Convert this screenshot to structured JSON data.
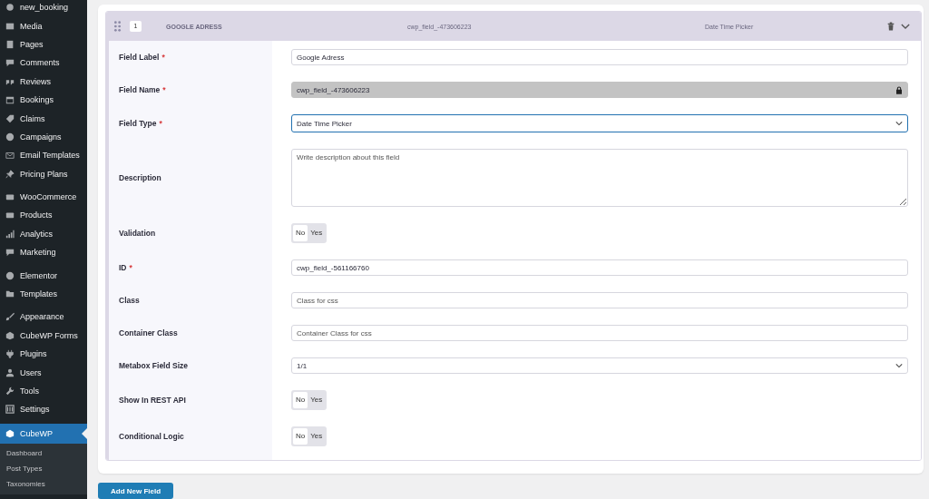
{
  "sidebar": {
    "groups": [
      {
        "items": [
          {
            "label": "new_booking",
            "selected": false
          },
          {
            "label": "Media",
            "selected": false
          },
          {
            "label": "Pages",
            "selected": false
          },
          {
            "label": "Comments",
            "selected": false
          },
          {
            "label": "Reviews",
            "selected": false
          },
          {
            "label": "Bookings",
            "selected": false
          },
          {
            "label": "Claims",
            "selected": false
          },
          {
            "label": "Campaigns",
            "selected": false
          },
          {
            "label": "Email Templates",
            "selected": false
          },
          {
            "label": "Pricing Plans",
            "selected": false
          }
        ]
      },
      {
        "items": [
          {
            "label": "WooCommerce",
            "selected": false
          },
          {
            "label": "Products",
            "selected": false
          },
          {
            "label": "Analytics",
            "selected": false
          },
          {
            "label": "Marketing",
            "selected": false
          }
        ]
      },
      {
        "items": [
          {
            "label": "Elementor",
            "selected": false
          },
          {
            "label": "Templates",
            "selected": false
          }
        ]
      },
      {
        "items": [
          {
            "label": "Appearance",
            "selected": false
          },
          {
            "label": "CubeWP Forms",
            "selected": false
          },
          {
            "label": "Plugins",
            "selected": false
          },
          {
            "label": "Users",
            "selected": false
          },
          {
            "label": "Tools",
            "selected": false
          },
          {
            "label": "Settings",
            "selected": false
          }
        ]
      },
      {
        "items": [
          {
            "label": "CubeWP",
            "selected": true
          }
        ]
      }
    ],
    "submenu": [
      {
        "label": "Dashboard",
        "selected": false
      },
      {
        "label": "Post Types",
        "selected": false
      },
      {
        "label": "Taxonomies",
        "selected": false
      }
    ]
  },
  "field": {
    "number": "1",
    "title": "GOOGLE ADRESS",
    "key": "cwp_field_-473606223",
    "type": "Date Time Picker",
    "rows": [
      {
        "kind": "text",
        "label": "Field Label",
        "marker": "*",
        "value": "Google Adress"
      },
      {
        "kind": "locked",
        "label": "Field Name",
        "marker": "*",
        "value": "cwp_field_-473606223"
      },
      {
        "kind": "select",
        "label": "Field Type",
        "marker": "*",
        "value": "Date Time Picker",
        "focused": true
      },
      {
        "kind": "textarea",
        "label": "Description",
        "placeholder": "Write description about this field"
      },
      {
        "kind": "toggle",
        "label": "Validation",
        "options": [
          {
            "label": "No",
            "selected": true
          },
          {
            "label": "Yes",
            "selected": false
          }
        ]
      },
      {
        "kind": "text",
        "label": "ID",
        "marker": "*",
        "value": "cwp_field_-561166760"
      },
      {
        "kind": "text",
        "label": "Class",
        "placeholder": "Class for css"
      },
      {
        "kind": "text",
        "label": "Container Class",
        "placeholder": "Container Class for css"
      },
      {
        "kind": "select",
        "label": "Metabox Field Size",
        "value": "1/1",
        "focused": false
      },
      {
        "kind": "toggle",
        "label": "Show In REST API",
        "options": [
          {
            "label": "No",
            "selected": true
          },
          {
            "label": "Yes",
            "selected": false
          }
        ]
      },
      {
        "kind": "toggle",
        "label": "Conditional Logic",
        "options": [
          {
            "label": "No",
            "selected": true
          },
          {
            "label": "Yes",
            "selected": false
          }
        ]
      }
    ]
  },
  "add_button": "Add New Field"
}
